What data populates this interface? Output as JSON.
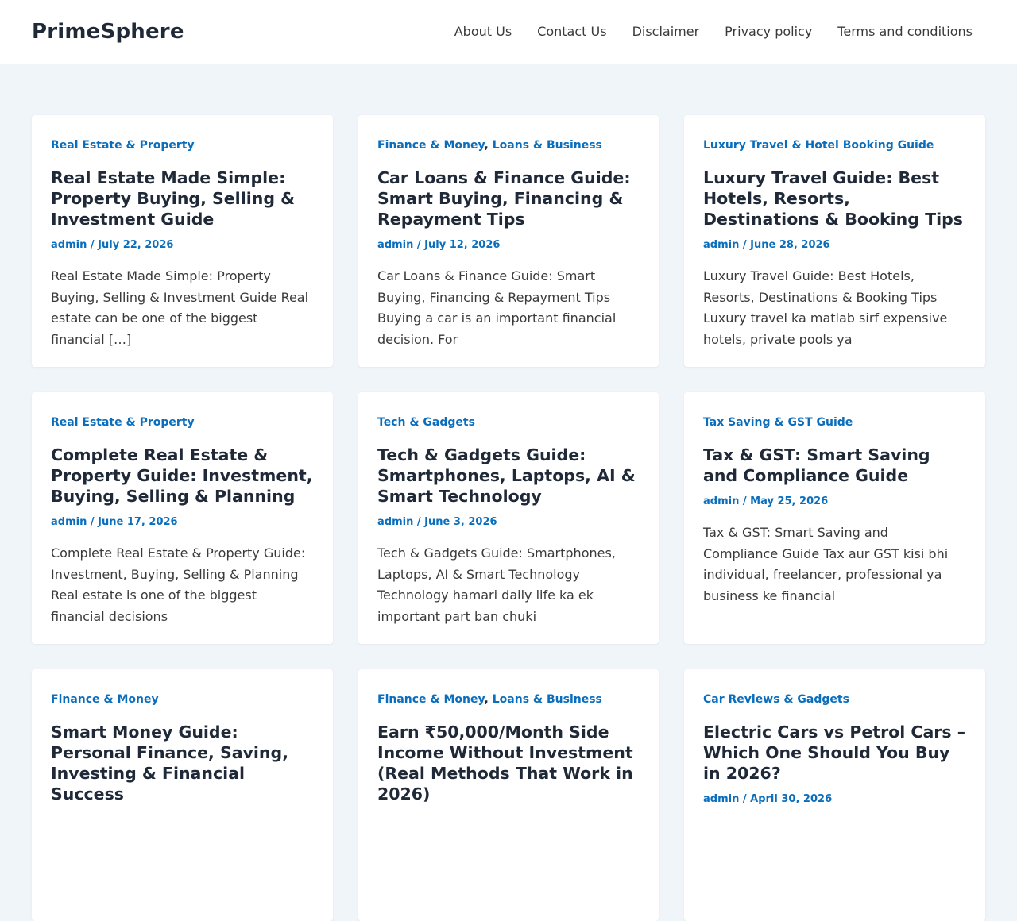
{
  "site": {
    "title": "PrimeSphere"
  },
  "nav": {
    "items": [
      {
        "label": "About Us"
      },
      {
        "label": "Contact Us"
      },
      {
        "label": "Disclaimer"
      },
      {
        "label": "Privacy policy"
      },
      {
        "label": "Terms and conditions"
      }
    ]
  },
  "posts": [
    {
      "categories": [
        "Real Estate & Property"
      ],
      "title": "Real Estate Made Simple: Property Buying, Selling & Investment Guide",
      "author": "admin",
      "date": "July 22, 2026",
      "excerpt": "Real Estate Made Simple: Property Buying, Selling & Investment Guide Real estate can be one of the biggest financial […]"
    },
    {
      "categories": [
        "Finance & Money",
        "Loans & Business"
      ],
      "title": "Car Loans & Finance Guide: Smart Buying, Financing & Repayment Tips",
      "author": "admin",
      "date": "July 12, 2026",
      "excerpt": "Car Loans & Finance Guide: Smart Buying, Financing & Repayment Tips Buying a car is an important financial decision. For"
    },
    {
      "categories": [
        "Luxury Travel & Hotel Booking Guide"
      ],
      "title": "Luxury Travel Guide: Best Hotels, Resorts, Destinations & Booking Tips",
      "author": "admin",
      "date": "June 28, 2026",
      "excerpt": "Luxury Travel Guide: Best Hotels, Resorts, Destinations & Booking Tips Luxury travel ka matlab sirf expensive hotels, private pools ya"
    },
    {
      "categories": [
        "Real Estate & Property"
      ],
      "title": "Complete Real Estate & Property Guide: Investment, Buying, Selling & Planning",
      "author": "admin",
      "date": "June 17, 2026",
      "excerpt": "Complete Real Estate & Property Guide: Investment, Buying, Selling & Planning Real estate is one of the biggest financial decisions"
    },
    {
      "categories": [
        "Tech & Gadgets"
      ],
      "title": "Tech & Gadgets Guide: Smartphones, Laptops, AI & Smart Technology",
      "author": "admin",
      "date": "June 3, 2026",
      "excerpt": "Tech & Gadgets Guide: Smartphones, Laptops, AI & Smart Technology Technology hamari daily life ka ek important part ban chuki"
    },
    {
      "categories": [
        "Tax Saving & GST Guide"
      ],
      "title": "Tax & GST: Smart Saving and Compliance Guide",
      "author": "admin",
      "date": "May 25, 2026",
      "excerpt": "Tax & GST: Smart Saving and Compliance Guide Tax aur GST kisi bhi individual, freelancer, professional ya business ke financial"
    },
    {
      "categories": [
        "Finance & Money"
      ],
      "title": "Smart Money Guide: Personal Finance, Saving, Investing & Financial Success",
      "author": "",
      "date": "",
      "excerpt": ""
    },
    {
      "categories": [
        "Finance & Money",
        "Loans & Business"
      ],
      "title": "Earn ₹50,000/Month Side Income Without Investment (Real Methods That Work in 2026)",
      "author": "",
      "date": "",
      "excerpt": ""
    },
    {
      "categories": [
        "Car Reviews & Gadgets"
      ],
      "title": "Electric Cars vs Petrol Cars – Which One Should You Buy in 2026?",
      "author": "admin",
      "date": "April 30, 2026",
      "excerpt": ""
    }
  ]
}
